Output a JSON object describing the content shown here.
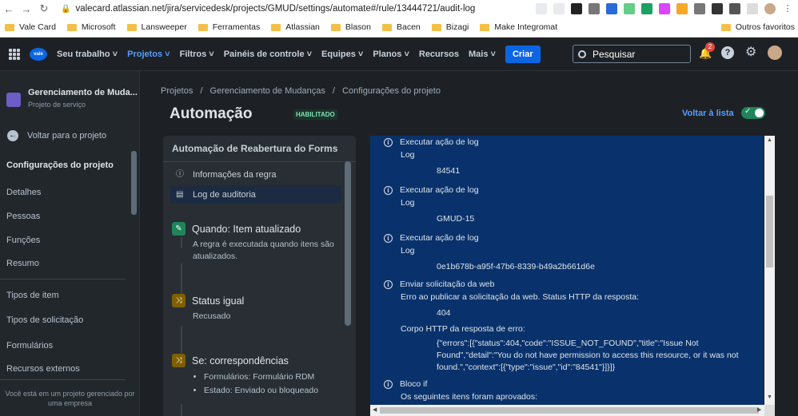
{
  "browser": {
    "url": "valecard.atlassian.net/jira/servicedesk/projects/GMUD/settings/automate#/rule/13444721/audit-log",
    "bookmarks": [
      "Vale Card",
      "Microsoft",
      "Lansweeper",
      "Ferramentas",
      "Atlassian",
      "Blason",
      "Bacen",
      "Bizagi",
      "Make Integromat"
    ],
    "other_bookmarks": "Outros favoritos"
  },
  "topnav": {
    "logo": "vale",
    "items": [
      "Seu trabalho ˅",
      "Projetos ˅",
      "Filtros ˅",
      "Painéis de controle ˅",
      "Equipes ˅",
      "Planos ˅",
      "Recursos",
      "Mais ˅"
    ],
    "create_label": "Criar",
    "search_placeholder": "Pesquisar",
    "notification_count": "2"
  },
  "sidebar": {
    "project_name": "Gerenciamento de Muda...",
    "project_type": "Projeto de serviço",
    "back_label": "Voltar para o projeto",
    "section_title": "Configurações do projeto",
    "items_a": [
      "Detalhes",
      "Pessoas",
      "Funções",
      "Resumo"
    ],
    "items_b": [
      "Tipos de item",
      "Tipos de solicitação",
      "Formulários",
      "Recursos externos"
    ],
    "footer": "Você está em um projeto gerenciado por uma empresa"
  },
  "breadcrumb": {
    "items": [
      "Projetos",
      "Gerenciamento de Mudanças",
      "Configurações do projeto"
    ],
    "separator": "/"
  },
  "page": {
    "title": "Automação",
    "status": "HABILITADO",
    "back_to_list": "Voltar à lista",
    "toggle_on": true
  },
  "rule_panel": {
    "rule_name": "Automação de Reabertura do Forms",
    "menu": [
      "Informações da regra",
      "Log de auditoria"
    ],
    "components": [
      {
        "title": "Quando: Item atualizado",
        "desc": "A regra é executada quando itens são atualizados.",
        "color": "#1f845a"
      },
      {
        "title": "Status igual",
        "desc": "Recusado",
        "color": "#7f5f01"
      },
      {
        "title": "Se: correspondências",
        "bullets": [
          "Formulários: Formulário RDM",
          "Estado: Enviado ou bloqueado"
        ],
        "color": "#7f5f01"
      }
    ]
  },
  "audit_log": {
    "entries": [
      {
        "title": "Executar ação de log",
        "line": "Log",
        "value": "84541"
      },
      {
        "title": "Executar ação de log",
        "line": "Log",
        "value": "GMUD-15"
      },
      {
        "title": "Executar ação de log",
        "line": "Log",
        "value": "0e1b678b-a95f-47b6-8339-b49a2b661d6e"
      },
      {
        "title": "Enviar solicitação da web",
        "line": "Erro ao publicar a solicitação da web. Status HTTP da resposta:",
        "value": "404",
        "line2": "Corpo HTTP da resposta de erro:",
        "body": "{\"errors\":[{\"status\":404,\"code\":\"ISSUE_NOT_FOUND\",\"title\":\"Issue Not Found\",\"detail\":\"You do not have permission to access this resource, or it was not found.\",\"context\":[{\"type\":\"issue\",\"id\":\"84541\"}]}]}"
      },
      {
        "title": "Bloco if",
        "line": "Os seguintes itens foram aprovados:"
      }
    ]
  }
}
